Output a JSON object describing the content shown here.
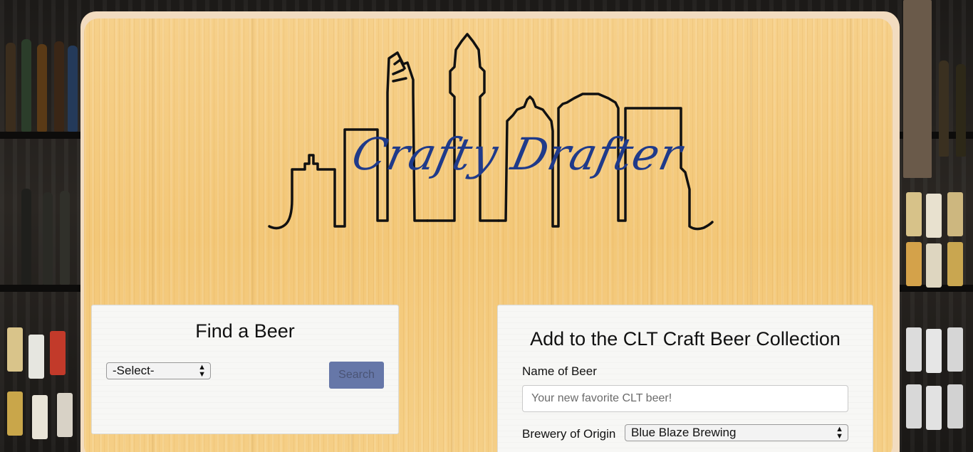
{
  "header": {
    "logo_text": "Crafty Drafter"
  },
  "find_panel": {
    "title": "Find a Beer",
    "select_value": "-Select-",
    "search_label": "Search"
  },
  "add_panel": {
    "title": "Add to the CLT Craft Beer Collection",
    "name_label": "Name of Beer",
    "name_placeholder": "Your new favorite CLT beer!",
    "brewery_label": "Brewery of Origin",
    "brewery_value": "Blue Blaze Brewing"
  },
  "colors": {
    "logo_text": "#1f3a8a",
    "search_button": "#6677a8",
    "board": "#f3c777"
  },
  "icons": {
    "select_arrows": "up-down-arrows-icon",
    "skyline": "charlotte-skyline-icon"
  }
}
